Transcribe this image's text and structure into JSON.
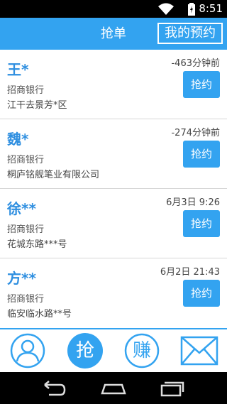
{
  "status": {
    "time": "8:51"
  },
  "header": {
    "title": "抢单",
    "my_appointments": "我的预约"
  },
  "orders": [
    {
      "name": "王*",
      "time": "-463分钟前",
      "bank": "招商银行",
      "address": "江干去景芳*区",
      "button": "抢约"
    },
    {
      "name": "魏*",
      "time": "-274分钟前",
      "bank": "招商银行",
      "address": "桐庐铭舰笔业有限公司",
      "button": "抢约"
    },
    {
      "name": "徐**",
      "time": "6月3日 9:26",
      "bank": "招商银行",
      "address": "花城东路***号",
      "button": "抢约"
    },
    {
      "name": "方**",
      "time": "6月2日 21:43",
      "bank": "招商银行",
      "address": "临安临水路**号",
      "button": "抢约"
    }
  ],
  "tabs": [
    {
      "icon": "profile-icon"
    },
    {
      "icon": "grab-icon",
      "label": "抢"
    },
    {
      "icon": "earn-icon",
      "label": "赚"
    },
    {
      "icon": "mail-icon"
    }
  ],
  "colors": {
    "accent": "#33a3f0",
    "name": "#2f8fe0"
  }
}
